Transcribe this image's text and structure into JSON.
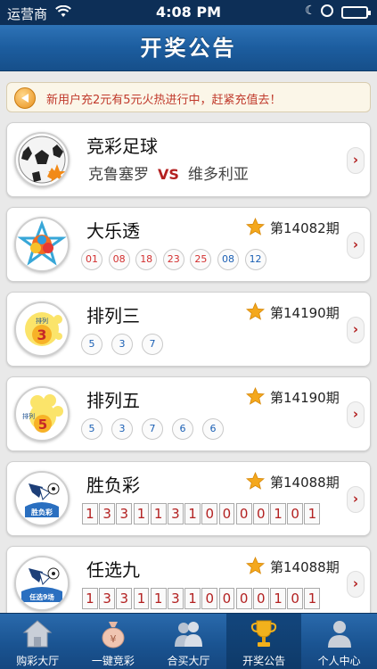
{
  "status_bar": {
    "carrier": "运营商",
    "time": "4:08 PM"
  },
  "header": {
    "title": "开奖公告"
  },
  "notice": {
    "text": "新用户充2元有5元火热进行中，赶紧充值去！"
  },
  "lotteries": [
    {
      "name": "竞彩足球",
      "home_team": "克鲁塞罗",
      "vs": "VS",
      "away_team": "维多利亚"
    },
    {
      "name": "大乐透",
      "issue": "第14082期",
      "red_balls": [
        "01",
        "08",
        "18",
        "23",
        "25"
      ],
      "blue_balls": [
        "08",
        "12"
      ]
    },
    {
      "name": "排列三",
      "issue": "第14190期",
      "numbers": [
        "5",
        "3",
        "7"
      ]
    },
    {
      "name": "排列五",
      "issue": "第14190期",
      "numbers": [
        "5",
        "3",
        "7",
        "6",
        "6"
      ]
    },
    {
      "name": "胜负彩",
      "issue": "第14088期",
      "digits": [
        "1",
        "3",
        "3",
        "1",
        "1",
        "3",
        "1",
        "0",
        "0",
        "0",
        "0",
        "1",
        "0",
        "1"
      ]
    },
    {
      "name": "任选九",
      "issue": "第14088期",
      "digits": [
        "1",
        "3",
        "3",
        "1",
        "1",
        "3",
        "1",
        "0",
        "0",
        "0",
        "0",
        "1",
        "0",
        "1"
      ]
    }
  ],
  "logo_texts": {
    "pl3": "排列",
    "pl3_num": "3",
    "pl5": "排列",
    "pl5_num": "5",
    "sfc": "胜负彩",
    "rx9": "任选9场"
  },
  "tabs": [
    {
      "label": "购彩大厅",
      "icon": "house-icon"
    },
    {
      "label": "一键竞彩",
      "icon": "money-bag-icon"
    },
    {
      "label": "合买大厅",
      "icon": "group-icon"
    },
    {
      "label": "开奖公告",
      "icon": "trophy-icon",
      "active": true
    },
    {
      "label": "个人中心",
      "icon": "person-icon"
    }
  ],
  "colors": {
    "header_blue": "#1c5d9f",
    "accent_red": "#b32121",
    "ball_blue": "#1a5fb4",
    "star": "#f4a81d"
  }
}
